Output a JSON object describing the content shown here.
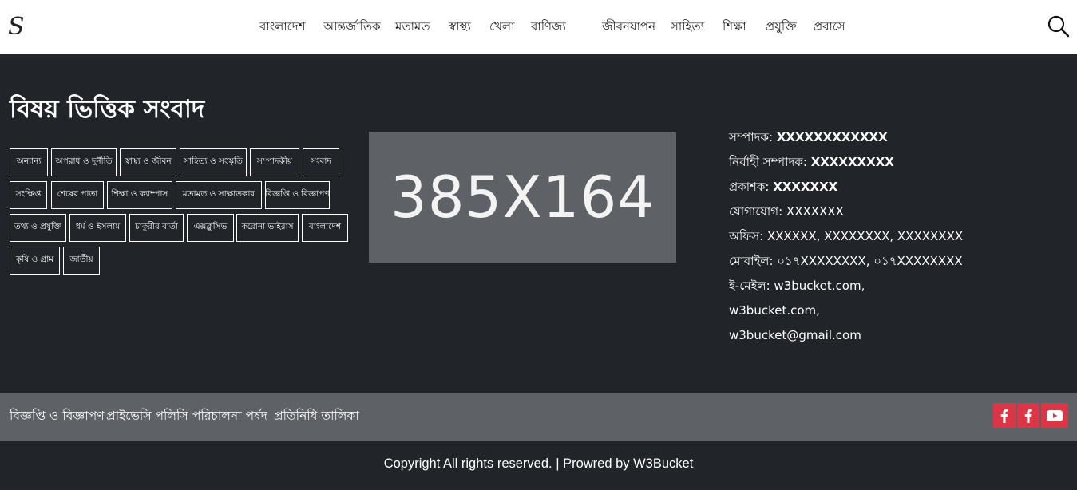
{
  "header": {
    "logo_text": "S",
    "nav": [
      "বাংলাদেশ",
      "আন্তর্জাতিক",
      "মতামত",
      "স্বাস্থ্য",
      "খেলা",
      "বাণিজ্য",
      "জীবনযাপন",
      "সাহিত্য",
      "শিক্ষা",
      "প্রযুক্তি",
      "প্রবাসে"
    ],
    "search_icon": "search-icon"
  },
  "section": {
    "title": "বিষয় ভিত্তিক সংবাদ",
    "tags": [
      "অন্যান্য",
      "অপরাধ ও দুর্নীতি",
      "স্বাস্থ্য ও জীবন",
      "সাহিত্য ও সংস্কৃতি",
      "সম্পাদকীয়",
      "সংবাদ",
      "সংক্ষিপ্ত",
      "শেষের পাতা",
      "শিক্ষা ও ক্যাম্পাস",
      "মতামত ও সাক্ষাতকার",
      "বিজ্ঞপ্তি ও বিজ্ঞাপণ",
      "তথ্য ও প্রযুক্তি",
      "ধর্ম ও ইসলাম",
      "চাকুরীর বার্তা",
      "এক্সক্লুসিভ",
      "করোনা ভাইরাস",
      "বাংলাদেশ",
      "কৃষি ও গ্রাম",
      "জাতীয়"
    ]
  },
  "placeholder": {
    "text": "385X164"
  },
  "info": {
    "editor_label": "সম্পাদক:",
    "editor_value": "XXXXXXXXXXXX",
    "exec_label": "নির্বাহী সম্পাদক:",
    "exec_value": "XXXXXXXXX",
    "publisher_label": "প্রকাশক:",
    "publisher_value": "XXXXXXX",
    "contact_line": "যোগাযোগ: XXXXXXX",
    "office_line": "অফিস: XXXXXX, XXXXXXXX, XXXXXXXX",
    "mobile_line": "মোবাইল: ০১৭XXXXXXXX, ০১৭XXXXXXXX",
    "email_line1": "ই-মেইল: w3bucket.com,",
    "email_line2": "w3bucket.com,",
    "email_line3": "w3bucket@gmail.com"
  },
  "footer": {
    "links": [
      "বিজ্ঞপ্তি ও বিজ্ঞাপণ",
      "প্রাইভেসি পলিসি",
      "পরিচালনা পর্ষদ",
      "প্রতিনিধি তালিকা"
    ],
    "social": [
      "facebook-icon",
      "facebook-icon",
      "youtube-icon"
    ],
    "accent": "#dc3545",
    "copyright": "Copyright All rights reserved. | Prowred by W3Bucket"
  }
}
